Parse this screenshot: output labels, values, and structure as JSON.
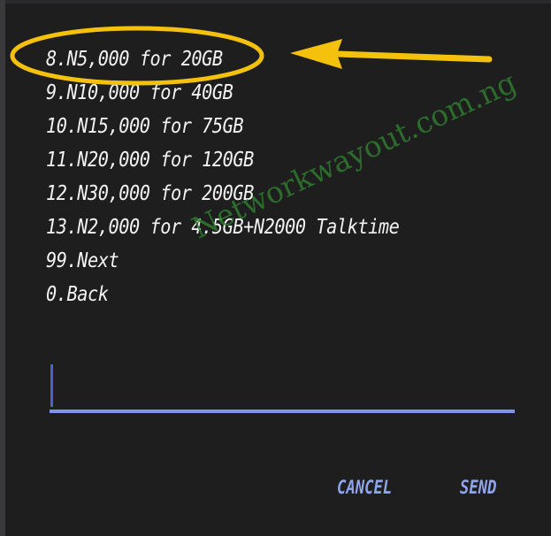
{
  "menu": {
    "items": [
      "8.N5,000 for 20GB",
      "9.N10,000 for 40GB",
      "10.N15,000 for 75GB",
      "11.N20,000 for 120GB",
      "12.N30,000 for 200GB",
      "13.N2,000 for 4.5GB+N2000 Talktime",
      "99.Next",
      "0.Back"
    ]
  },
  "watermark": "Networkwayout.com.ng",
  "input": {
    "value": ""
  },
  "buttons": {
    "cancel": "CANCEL",
    "send": "SEND"
  },
  "colors": {
    "background": "#1e1e1e",
    "text": "#f2f2f2",
    "accent": "#8ea5ee",
    "annotation": "#f4c20d",
    "watermark": "#2f7a2f"
  },
  "icons": {
    "annotation": [
      "highlight-ellipse",
      "pointer-arrow-icon"
    ]
  }
}
